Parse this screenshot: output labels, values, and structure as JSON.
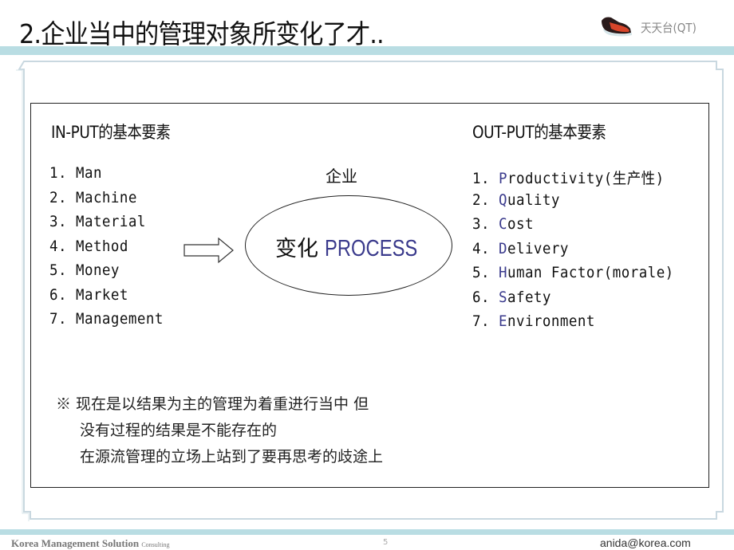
{
  "header": {
    "title": "2.企业当中的管理对象所变化了才..",
    "logo_icon": "sneaker-icon",
    "logo_text": "天天台(QT)"
  },
  "input": {
    "heading": "IN-PUT的基本要素",
    "items": [
      {
        "num": "1.",
        "label": "Man"
      },
      {
        "num": "2.",
        "label": "Machine"
      },
      {
        "num": "3.",
        "label": "Material"
      },
      {
        "num": "4.",
        "label": "Method"
      },
      {
        "num": "5.",
        "label": "Money"
      },
      {
        "num": "6.",
        "label": "Market"
      },
      {
        "num": "7.",
        "label": "Management"
      }
    ]
  },
  "process": {
    "company_label": "企业",
    "change_label": "变化",
    "process_label": "PROCESS",
    "arrow_icon": "right-arrow-icon"
  },
  "output": {
    "heading": "OUT-PUT的基本要素",
    "items": [
      {
        "num": "1.",
        "initial": "P",
        "rest": "roductivity(生产性)"
      },
      {
        "num": "2.",
        "initial": "Q",
        "rest": "uality"
      },
      {
        "num": "3.",
        "initial": "C",
        "rest": "ost"
      },
      {
        "num": "4.",
        "initial": "D",
        "rest": "elivery"
      },
      {
        "num": "5.",
        "initial": "H",
        "rest": "uman Factor(morale)"
      },
      {
        "num": "6.",
        "initial": "S",
        "rest": "afety"
      },
      {
        "num": "7.",
        "initial": "E",
        "rest": "nvironment"
      }
    ]
  },
  "note": {
    "lines": [
      "※ 现在是以结果为主的管理为着重进行当中 但",
      "没有过程的结果是不能存在的",
      "在源流管理的立场上站到了要再思考的歧途上"
    ]
  },
  "footer": {
    "company": "Korea Management Solution",
    "company_suffix": "Consulting",
    "page_number": "5",
    "email": "anida@korea.com"
  },
  "colors": {
    "accent_band": "#b9dde3",
    "highlight_letter": "#3a3a8c"
  }
}
